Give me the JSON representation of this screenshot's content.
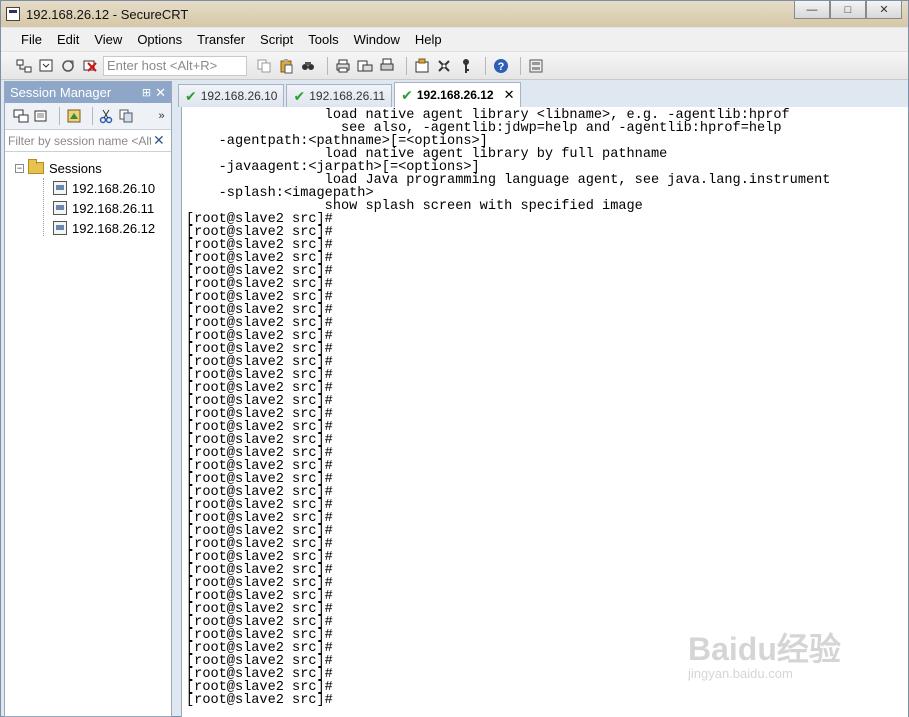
{
  "window": {
    "title": "192.168.26.12 - SecureCRT",
    "controls": {
      "minimize": "—",
      "maximize": "□",
      "close": "✕"
    }
  },
  "menubar": {
    "items": [
      "File",
      "Edit",
      "View",
      "Options",
      "Transfer",
      "Script",
      "Tools",
      "Window",
      "Help"
    ]
  },
  "toolbar": {
    "host_placeholder": "Enter host <Alt+R>"
  },
  "session_manager": {
    "title": "Session Manager",
    "pin_glyph": "⊞",
    "close_glyph": "✕",
    "filter_placeholder": "Filter by session name <Alt+I>",
    "root_label": "Sessions",
    "sessions": [
      "192.168.26.10",
      "192.168.26.11",
      "192.168.26.12"
    ]
  },
  "tabs": [
    {
      "label": "192.168.26.10",
      "active": false
    },
    {
      "label": "192.168.26.11",
      "active": false
    },
    {
      "label": "192.168.26.12",
      "active": true
    }
  ],
  "terminal": {
    "lines": [
      "                 load native agent library <libname>, e.g. -agentlib:hprof",
      "                   see also, -agentlib:jdwp=help and -agentlib:hprof=help",
      "    -agentpath:<pathname>[=<options>]",
      "                 load native agent library by full pathname",
      "    -javaagent:<jarpath>[=<options>]",
      "                 load Java programming language agent, see java.lang.instrument",
      "    -splash:<imagepath>",
      "                 show splash screen with specified image",
      "[root@slave2 src]#",
      "[root@slave2 src]#",
      "[root@slave2 src]#",
      "[root@slave2 src]#",
      "[root@slave2 src]#",
      "[root@slave2 src]#",
      "[root@slave2 src]#",
      "[root@slave2 src]#",
      "[root@slave2 src]#",
      "[root@slave2 src]#",
      "[root@slave2 src]#",
      "[root@slave2 src]#",
      "[root@slave2 src]#",
      "[root@slave2 src]#",
      "[root@slave2 src]#",
      "[root@slave2 src]#",
      "[root@slave2 src]#",
      "[root@slave2 src]#",
      "[root@slave2 src]#",
      "[root@slave2 src]#",
      "[root@slave2 src]#",
      "[root@slave2 src]#",
      "[root@slave2 src]#",
      "[root@slave2 src]#",
      "[root@slave2 src]#",
      "[root@slave2 src]#",
      "[root@slave2 src]#",
      "[root@slave2 src]#",
      "[root@slave2 src]#",
      "[root@slave2 src]#",
      "[root@slave2 src]#",
      "[root@slave2 src]#",
      "[root@slave2 src]#",
      "[root@slave2 src]#",
      "[root@slave2 src]#",
      "[root@slave2 src]#",
      "[root@slave2 src]#",
      "[root@slave2 src]#"
    ]
  },
  "watermark": {
    "brand": "Baidu经验",
    "url": "jingyan.baidu.com"
  },
  "colors": {
    "accent": "#8ea7c9",
    "check": "#2f9e2f",
    "terminal_bg": "#ffffff"
  }
}
